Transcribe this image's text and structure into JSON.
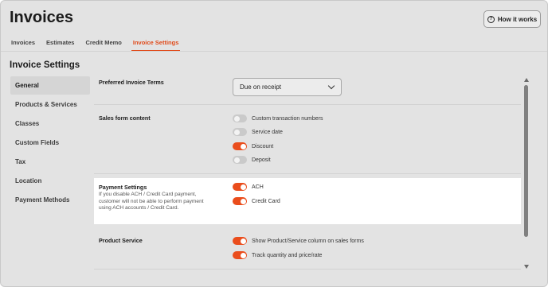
{
  "page": {
    "title": "Invoices",
    "help_button": "How it works"
  },
  "tabs": [
    {
      "label": "Invoices",
      "active": false
    },
    {
      "label": "Estimates",
      "active": false
    },
    {
      "label": "Credit Memo",
      "active": false
    },
    {
      "label": "Invoice Settings",
      "active": true
    }
  ],
  "section_title": "Invoice Settings",
  "sidebar": {
    "items": [
      {
        "label": "General",
        "active": true
      },
      {
        "label": "Products & Services",
        "active": false
      },
      {
        "label": "Classes",
        "active": false
      },
      {
        "label": "Custom Fields",
        "active": false
      },
      {
        "label": "Tax",
        "active": false
      },
      {
        "label": "Location",
        "active": false
      },
      {
        "label": "Payment Methods",
        "active": false
      }
    ]
  },
  "settings": {
    "preferred_terms": {
      "label": "Preferred Invoice Terms",
      "value": "Due on receipt"
    },
    "sales_form": {
      "label": "Sales form content",
      "toggles": [
        {
          "label": "Custom transaction numbers",
          "on": false
        },
        {
          "label": "Service date",
          "on": false
        },
        {
          "label": "Discount",
          "on": true
        },
        {
          "label": "Deposit",
          "on": false
        }
      ]
    },
    "payment": {
      "label": "Payment Settings",
      "description": "If you disable ACH / Credit Card payment, customer will not be able to perform payment using ACH accounts / Credit Card.",
      "toggles": [
        {
          "label": "ACH",
          "on": true
        },
        {
          "label": "Credit Card",
          "on": true
        }
      ]
    },
    "product_service": {
      "label": "Product Service",
      "toggles": [
        {
          "label": "Show Product/Service column on sales forms",
          "on": true
        },
        {
          "label": "Track quantity and price/rate",
          "on": true
        }
      ]
    }
  },
  "colors": {
    "accent": "#ea4d1c",
    "toggle_off": "#cacaca",
    "background": "#e3e3e3"
  }
}
